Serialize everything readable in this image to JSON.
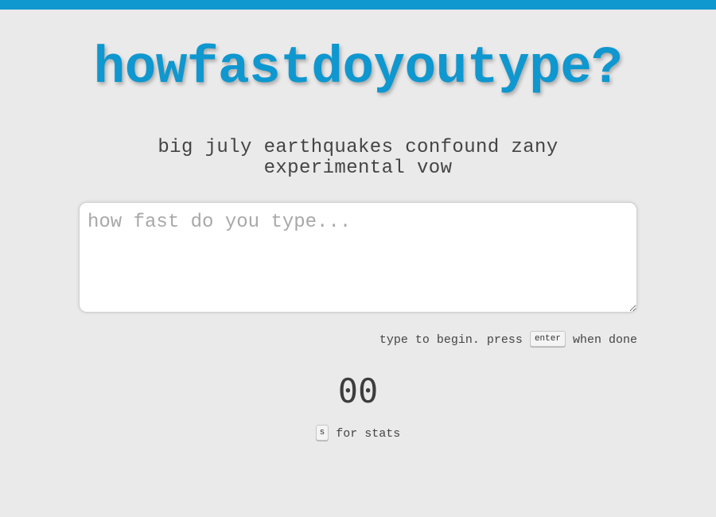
{
  "header": {
    "accent_color": "#0f97cf"
  },
  "app": {
    "title": "howfastdoyoutype?"
  },
  "prompt": {
    "text": "big july earthquakes confound zany experimental vow"
  },
  "input": {
    "value": "",
    "placeholder": "how fast do you type..."
  },
  "hint": {
    "before": "type to begin. press",
    "key": "enter",
    "after": "when done"
  },
  "timer": {
    "value": "00"
  },
  "stats_hint": {
    "key": "s",
    "text": "for stats"
  }
}
